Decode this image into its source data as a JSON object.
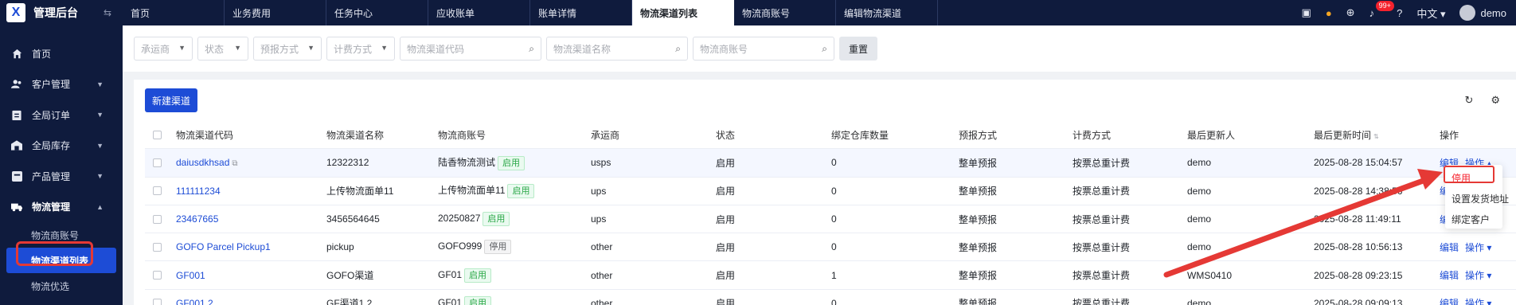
{
  "app": {
    "title": "管理后台"
  },
  "sidebar": {
    "items": [
      {
        "label": "首页",
        "icon": "home-icon"
      },
      {
        "label": "客户管理",
        "icon": "user-group-icon"
      },
      {
        "label": "全局订单",
        "icon": "order-icon"
      },
      {
        "label": "全局库存",
        "icon": "warehouse-icon"
      },
      {
        "label": "产品管理",
        "icon": "product-icon"
      },
      {
        "label": "物流管理",
        "icon": "truck-icon"
      }
    ],
    "sub_items": [
      {
        "label": "物流商账号"
      },
      {
        "label": "物流渠道列表"
      },
      {
        "label": "物流优选"
      }
    ]
  },
  "tabs": [
    {
      "label": "首页"
    },
    {
      "label": "业务费用"
    },
    {
      "label": "任务中心"
    },
    {
      "label": "应收账单"
    },
    {
      "label": "账单详情"
    },
    {
      "label": "物流渠道列表"
    },
    {
      "label": "物流商账号"
    },
    {
      "label": "编辑物流渠道"
    }
  ],
  "header": {
    "notifications": "99+",
    "language": "中文",
    "user": "demo"
  },
  "filters": {
    "carrier": "承运商",
    "status": "状态",
    "forecast": "预报方式",
    "billing": "计费方式",
    "channel_code": "物流渠道代码",
    "channel_name": "物流渠道名称",
    "account": "物流商账号",
    "reset": "重置"
  },
  "toolbar": {
    "new_channel": "新建渠道"
  },
  "table": {
    "headers": [
      "物流渠道代码",
      "物流渠道名称",
      "物流商账号",
      "承运商",
      "状态",
      "绑定仓库数量",
      "预报方式",
      "计费方式",
      "最后更新人",
      "最后更新时间",
      "操作"
    ],
    "rows": [
      {
        "code": "daiusdkhsad",
        "name": "12322312",
        "account": "陆香物流测试",
        "account_tag": "启用",
        "carrier": "usps",
        "status": "启用",
        "wh": "0",
        "forecast": "整单预报",
        "billing": "按票总重计费",
        "updater": "demo",
        "time": "2025-08-28 15:04:57"
      },
      {
        "code": "111111234",
        "name": "上传物流面单11",
        "account": "上传物流面单11",
        "account_tag": "启用",
        "carrier": "ups",
        "status": "启用",
        "wh": "0",
        "forecast": "整单预报",
        "billing": "按票总重计费",
        "updater": "demo",
        "time": "2025-08-28 14:38:56"
      },
      {
        "code": "23467665",
        "name": "3456564645",
        "account": "20250827",
        "account_tag": "启用",
        "carrier": "ups",
        "status": "启用",
        "wh": "0",
        "forecast": "整单预报",
        "billing": "按票总重计费",
        "updater": "demo",
        "time": "2025-08-28 11:49:11"
      },
      {
        "code": "GOFO Parcel Pickup1",
        "name": "pickup",
        "account": "GOFO999",
        "account_tag": "停用",
        "carrier": "other",
        "status": "启用",
        "wh": "0",
        "forecast": "整单预报",
        "billing": "按票总重计费",
        "updater": "demo",
        "time": "2025-08-28 10:56:13"
      },
      {
        "code": "GF001",
        "name": "GOFO渠道",
        "account": "GF01",
        "account_tag": "启用",
        "carrier": "other",
        "status": "启用",
        "wh": "1",
        "forecast": "整单预报",
        "billing": "按票总重计费",
        "updater": "WMS0410",
        "time": "2025-08-28 09:23:15"
      },
      {
        "code": "GF001.2",
        "name": "GF渠道1.2",
        "account": "GF01",
        "account_tag": "启用",
        "carrier": "other",
        "status": "启用",
        "wh": "0",
        "forecast": "整单预报",
        "billing": "按票总重计费",
        "updater": "demo",
        "time": "2025-08-28 09:09:13"
      }
    ],
    "edit": "编辑",
    "ops": "操作"
  },
  "dropdown": {
    "items": [
      "停用",
      "设置发货地址",
      "绑定客户"
    ]
  },
  "colors": {
    "primary": "#1d4cd6",
    "sidebar": "#0f1b3d",
    "success": "#28a745",
    "annotation": "#e53935"
  }
}
